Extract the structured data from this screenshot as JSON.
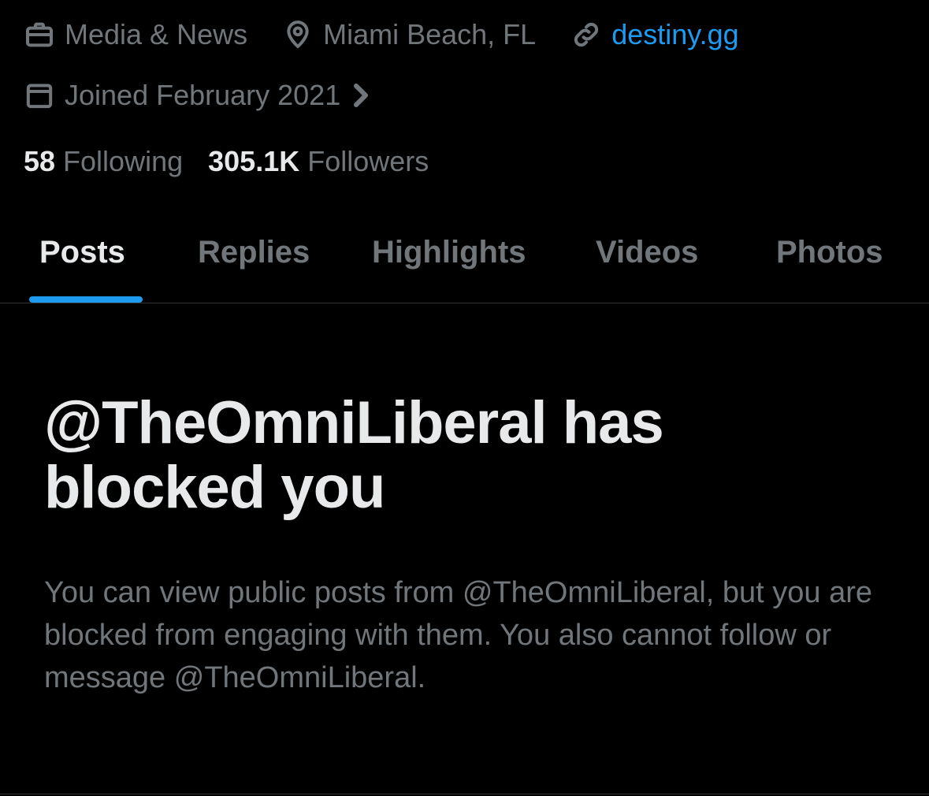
{
  "profile": {
    "category": "Media & News",
    "location": "Miami Beach, FL",
    "website": "destiny.gg",
    "joined": "Joined February 2021",
    "following_count": "58",
    "following_label": "Following",
    "followers_count": "305.1K",
    "followers_label": "Followers"
  },
  "tabs": [
    {
      "label": "Posts",
      "active": true
    },
    {
      "label": "Replies",
      "active": false
    },
    {
      "label": "Highlights",
      "active": false
    },
    {
      "label": "Videos",
      "active": false
    },
    {
      "label": "Photos",
      "active": false
    }
  ],
  "blocked": {
    "title": "@TheOmniLiberal has blocked you",
    "message": "You can view public posts from @TheOmniLiberal, but you are blocked from engaging with them. You also cannot follow or message @TheOmniLiberal."
  },
  "icons": {
    "category": "briefcase-icon",
    "location": "location-pin-icon",
    "website": "link-icon",
    "joined": "calendar-icon",
    "joined_more": "chevron-right-icon"
  },
  "colors": {
    "background": "#000000",
    "primary_text": "#e7e9ea",
    "secondary_text": "#71767b",
    "accent": "#1d9bf0",
    "divider": "#2f3336"
  }
}
